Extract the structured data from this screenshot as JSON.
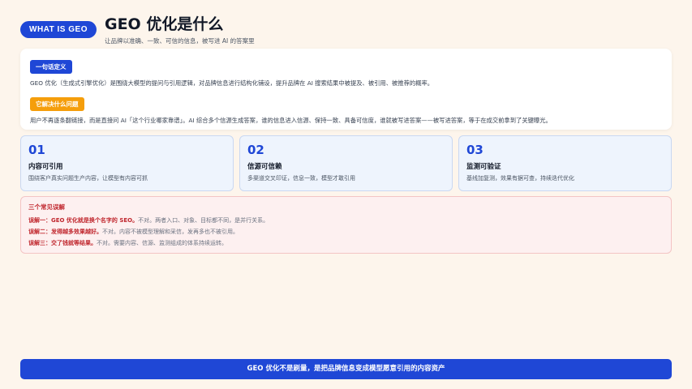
{
  "header": {
    "badge": "WHAT IS GEO",
    "title": "GEO 优化是什么",
    "subtitle": "让品牌以准确、一致、可信的信息，被写进 AI 的答案里"
  },
  "definition": {
    "tag1": "一句话定义",
    "text1": "GEO 优化（生成式引擎优化）是围绕大模型的提问与引用逻辑，对品牌信息进行结构化铺设，提升品牌在 AI 搜索结果中被提及、被引用、被推荐的概率。",
    "tag2": "它解决什么问题",
    "text2": "用户不再逐条翻链接，而是直接问 AI「这个行业哪家靠谱」。AI 综合多个信源生成答案，谁的信息进入信源、保持一致、具备可信度，谁就被写进答案——被写进答案，等于在成交前拿到了关键曝光。"
  },
  "cards": [
    {
      "num": "01",
      "title": "内容可引用",
      "desc": "围绕客户真实问题生产内容，让模型有内容可抓"
    },
    {
      "num": "02",
      "title": "信源可信赖",
      "desc": "多渠道交叉印证，信息一致，模型才敢引用"
    },
    {
      "num": "03",
      "title": "监测可验证",
      "desc": "基线加复测，效果有据可查，持续迭代优化"
    }
  ],
  "misconceptions": {
    "title": "三个常见误解",
    "items": [
      {
        "lead": "误解一：GEO 优化就是换个名字的 SEO。",
        "rest": "不对。两者入口、对象、目标都不同，是并行关系。"
      },
      {
        "lead": "误解二：发得越多效果越好。",
        "rest": "不对。内容不被模型理解和采信，发再多也不被引用。"
      },
      {
        "lead": "误解三：交了钱就等结果。",
        "rest": "不对。需要内容、信源、监测组成的体系持续运转。"
      }
    ]
  },
  "footer": {
    "text": "GEO 优化不是刷量，是把品牌信息变成模型愿意引用的内容资产"
  },
  "colors": {
    "accent": "#1f47d6",
    "orange": "#f59e0b",
    "red": "#c0262d",
    "background": "#fdf5ec"
  }
}
